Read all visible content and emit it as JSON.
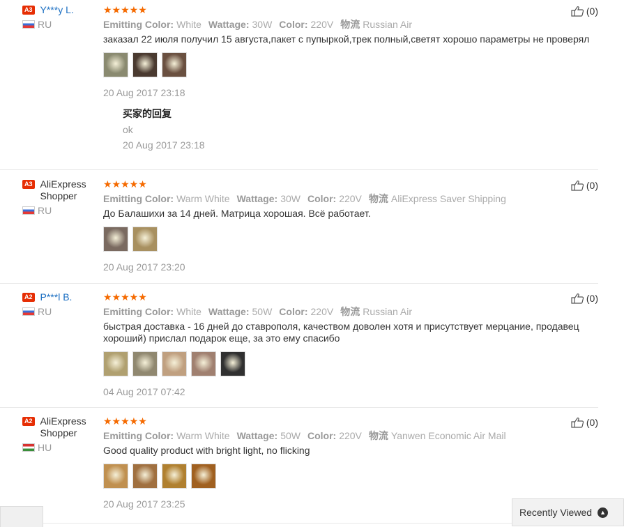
{
  "reviews": [
    {
      "badge": "A3",
      "name": "Y***y L.",
      "name_style": "link",
      "country": "RU",
      "flag": "ru",
      "stars": "★★★★★",
      "attrs": [
        {
          "k": "Emitting Color:",
          "v": "White"
        },
        {
          "k": "Wattage:",
          "v": "30W"
        },
        {
          "k": "Color:",
          "v": "220V"
        },
        {
          "k": "物流",
          "v": "Russian Air"
        }
      ],
      "text": "заказал 22 июля получил 15 августа,пакет с пупыркой,трек полный,светят хорошо параметры не проверял",
      "photos": [
        "#8a8a70",
        "#4a3a30",
        "#6a5040"
      ],
      "date": "20 Aug 2017 23:18",
      "reply": {
        "title": "买家的回复",
        "text": "ok",
        "date": "20 Aug 2017 23:18"
      },
      "likes": "(0)"
    },
    {
      "badge": "A3",
      "name": "AliExpress Shopper",
      "name_style": "plain",
      "country": "RU",
      "flag": "ru",
      "stars": "★★★★★",
      "attrs": [
        {
          "k": "Emitting Color:",
          "v": "Warm White"
        },
        {
          "k": "Wattage:",
          "v": "30W"
        },
        {
          "k": "Color:",
          "v": "220V"
        },
        {
          "k": "物流",
          "v": "AliExpress Saver Shipping"
        }
      ],
      "text": "До Балашихи за 14 дней. Матрица хорошая. Всё работает.",
      "photos": [
        "#7a6a60",
        "#a89060"
      ],
      "date": "20 Aug 2017 23:20",
      "likes": "(0)"
    },
    {
      "badge": "A2",
      "name": "P***l B.",
      "name_style": "link",
      "country": "RU",
      "flag": "ru",
      "stars": "★★★★★",
      "attrs": [
        {
          "k": "Emitting Color:",
          "v": "White"
        },
        {
          "k": "Wattage:",
          "v": "50W"
        },
        {
          "k": "Color:",
          "v": "220V"
        },
        {
          "k": "物流",
          "v": "Russian Air"
        }
      ],
      "text": "быстрая доставка - 16 дней до ставрополя, качеством доволен хотя и присутствует мерцание, продавец хороший) прислал подарок еще, за это ему спасибо",
      "photos": [
        "#b0a070",
        "#908870",
        "#c0a080",
        "#a08070",
        "#303030"
      ],
      "date": "04 Aug 2017 07:42",
      "likes": "(0)"
    },
    {
      "badge": "A2",
      "name": "AliExpress Shopper",
      "name_style": "plain",
      "country": "HU",
      "flag": "hu",
      "stars": "★★★★★",
      "attrs": [
        {
          "k": "Emitting Color:",
          "v": "Warm White"
        },
        {
          "k": "Wattage:",
          "v": "50W"
        },
        {
          "k": "Color:",
          "v": "220V"
        },
        {
          "k": "物流",
          "v": "Yanwen Economic Air Mail"
        }
      ],
      "text": "Good quality product with bright light, no flicking",
      "photos": [
        "#c09050",
        "#a07040",
        "#b08030",
        "#a06020"
      ],
      "date": "20 Aug 2017 23:25",
      "likes": "(0)"
    }
  ],
  "recently_viewed": {
    "label": "Recently Viewed"
  },
  "icons": {
    "like": "thumbs-up-icon",
    "chevron": "chevron-up-icon"
  }
}
